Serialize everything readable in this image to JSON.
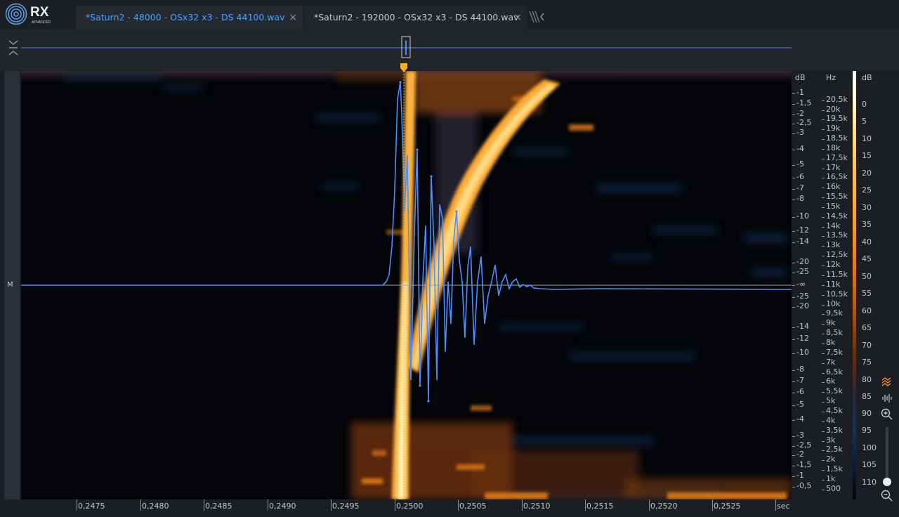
{
  "app": {
    "logo_text": "RX",
    "logo_subtext": "ADVANCED"
  },
  "tabs": [
    {
      "label": "*Saturn2 - 48000 - OSx32 x3 - DS 44100.wav",
      "active": true
    },
    {
      "label": "*Saturn2 - 192000 - OSx32 x3 - DS 44100.wav",
      "active": false
    }
  ],
  "tab_close_symbol": "×",
  "channel_label": "M",
  "right_axis": {
    "db_unit": "dB",
    "hz_unit": "Hz",
    "db_labels": [
      "-1",
      "-1,5",
      "-2",
      "-2,5",
      "-3",
      "-4",
      "-5",
      "-6",
      "-7",
      "-8",
      "-10",
      "-12",
      "-14",
      "-20",
      "-25",
      "-∞",
      "-25",
      "-20",
      "-14",
      "-12",
      "-10",
      "-8",
      "-7",
      "-6",
      "-5",
      "-4",
      "-3",
      "-2,5",
      "-2",
      "-1,5",
      "-1",
      "-0,5"
    ],
    "hz_labels": [
      "20,5k",
      "20k",
      "19,5k",
      "19k",
      "18,5k",
      "18k",
      "17,5k",
      "17k",
      "16,5k",
      "16k",
      "15,5k",
      "15k",
      "14,5k",
      "14k",
      "13,5k",
      "13k",
      "12,5k",
      "12k",
      "11,5k",
      "11k",
      "10,5k",
      "10k",
      "9,5k",
      "9k",
      "8,5k",
      "8k",
      "7,5k",
      "7k",
      "6,5k",
      "6k",
      "5,5k",
      "5k",
      "4,5k",
      "4k",
      "3,5k",
      "3k",
      "2,5k",
      "2k",
      "1,5k",
      "1k",
      "500"
    ]
  },
  "colorbar": {
    "unit": "dB",
    "labels": [
      "0",
      "5",
      "10",
      "15",
      "20",
      "25",
      "30",
      "35",
      "40",
      "45",
      "50",
      "55",
      "60",
      "65",
      "70",
      "75",
      "80",
      "85",
      "90",
      "95",
      "100",
      "105",
      "110"
    ]
  },
  "time_axis": {
    "labels": [
      "0,2475",
      "0,2480",
      "0,2485",
      "0,2490",
      "0,2495",
      "0,2500",
      "0,2505",
      "0,2510",
      "0,2515",
      "0,2520",
      "0,2525"
    ],
    "unit": "sec"
  },
  "colors": {
    "waveform": "#4b8fff",
    "playhead": "#ffb020",
    "spectrogram_hot": "#ffb23c",
    "spectrogram_cold": "#17305a",
    "active_tab_text": "#4aa0ff"
  },
  "icons": {
    "collapse": "collapse-icon",
    "more_tabs": "tab-overflow-icon",
    "spectrogram_view": "spectrogram-icon",
    "waveform_view": "waveform-icon",
    "zoom_in": "zoom-in-icon",
    "zoom_out": "zoom-out-icon"
  }
}
